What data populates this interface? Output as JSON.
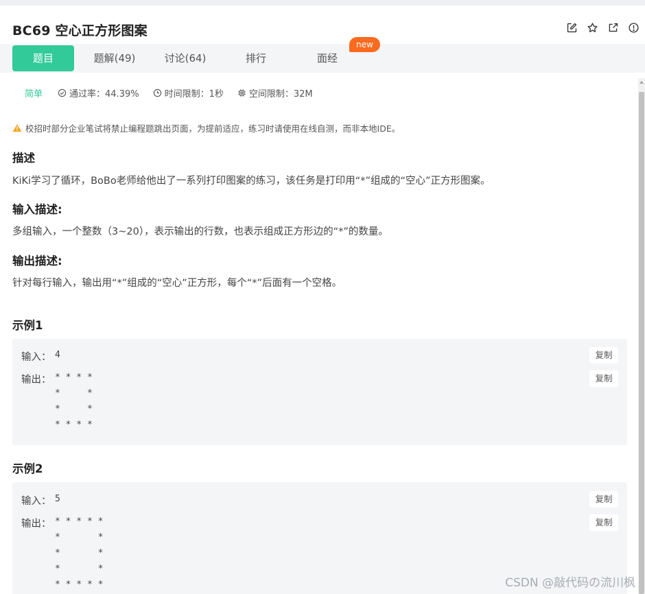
{
  "header": {
    "title": "BC69  空心正方形图案",
    "icons": [
      "edit-icon",
      "star-icon",
      "external-link-icon",
      "info-icon"
    ]
  },
  "tabs": [
    {
      "label": "题目",
      "active": true
    },
    {
      "label": "题解(49)"
    },
    {
      "label": "讨论(64)"
    },
    {
      "label": "排行"
    },
    {
      "label": "面经"
    }
  ],
  "badge": "new",
  "meta": {
    "difficulty": "简单",
    "pass_rate": "通过率：44.39%",
    "time_limit": "时间限制：1秒",
    "space_limit": "空间限制：32M"
  },
  "notice": "校招时部分企业笔试将禁止编程题跳出页面，为提前适应，练习时请使用在线自测，而非本地IDE。",
  "description": {
    "title": "描述",
    "text": "KiKi学习了循环，BoBo老师给他出了一系列打印图案的练习，该任务是打印用“*”组成的“空心”正方形图案。"
  },
  "input_desc": {
    "title": "输入描述:",
    "text": "多组输入，一个整数（3~20），表示输出的行数，也表示组成正方形边的“*”的数量。"
  },
  "output_desc": {
    "title": "输出描述:",
    "text": "针对每行输入，输出用“*”组成的“空心”正方形，每个“*”后面有一个空格。"
  },
  "examples": [
    {
      "title": "示例1",
      "input_label": "输入：",
      "input": "4",
      "output_label": "输出：",
      "output": "* * * * \n*     * \n*     * \n* * * * ",
      "copy_label": "复制"
    },
    {
      "title": "示例2",
      "input_label": "输入：",
      "input": "5",
      "output_label": "输出：",
      "output": "* * * * * \n*       * \n*       * \n*       * \n* * * * * ",
      "copy_label": "复制"
    }
  ],
  "watermark": "CSDN @敲代码の流川枫",
  "colors": {
    "accent": "#32ca99",
    "badge": "#fa6b20",
    "warning": "#f5a623"
  }
}
